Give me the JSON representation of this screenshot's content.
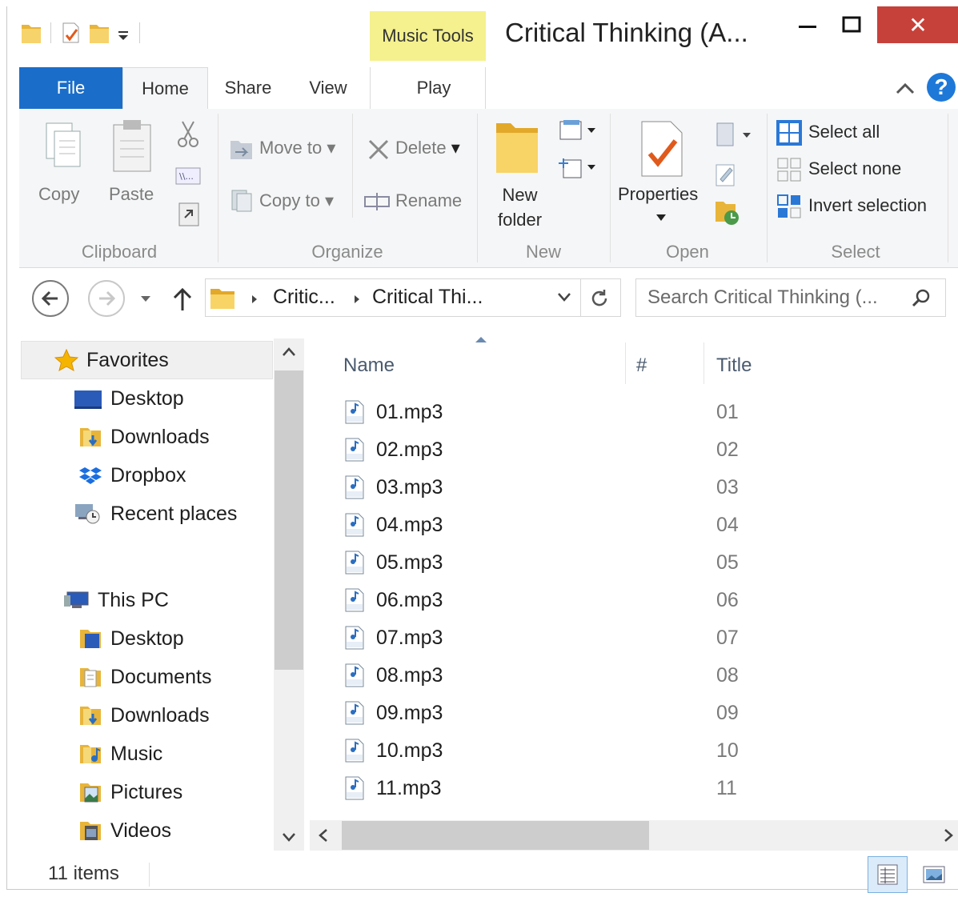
{
  "titlebar": {
    "context_tab": "Music Tools",
    "title": "Critical Thinking (A...",
    "close_glyph": "✕"
  },
  "tabs": {
    "file": "File",
    "home": "Home",
    "share": "Share",
    "view": "View",
    "play": "Play"
  },
  "ribbon": {
    "clipboard": {
      "copy": "Copy",
      "paste": "Paste",
      "label": "Clipboard"
    },
    "organize": {
      "move_to": "Move to",
      "copy_to": "Copy to",
      "delete": "Delete",
      "rename": "Rename",
      "label": "Organize"
    },
    "new": {
      "new_folder_line1": "New",
      "new_folder_line2": "folder",
      "label": "New"
    },
    "open": {
      "properties": "Properties",
      "label": "Open"
    },
    "select": {
      "select_all": "Select all",
      "select_none": "Select none",
      "invert": "Invert selection",
      "label": "Select"
    }
  },
  "address": {
    "crumb1": "Critic...",
    "crumb2": "Critical Thi...",
    "search_placeholder": "Search Critical Thinking (..."
  },
  "nav": {
    "favorites": "Favorites",
    "fav_items": [
      "Desktop",
      "Downloads",
      "Dropbox",
      "Recent places"
    ],
    "this_pc": "This PC",
    "pc_items": [
      "Desktop",
      "Documents",
      "Downloads",
      "Music",
      "Pictures",
      "Videos"
    ]
  },
  "columns": {
    "name": "Name",
    "number": "#",
    "title": "Title"
  },
  "files": [
    {
      "name": "01.mp3",
      "title": "01"
    },
    {
      "name": "02.mp3",
      "title": "02"
    },
    {
      "name": "03.mp3",
      "title": "03"
    },
    {
      "name": "04.mp3",
      "title": "04"
    },
    {
      "name": "05.mp3",
      "title": "05"
    },
    {
      "name": "06.mp3",
      "title": "06"
    },
    {
      "name": "07.mp3",
      "title": "07"
    },
    {
      "name": "08.mp3",
      "title": "08"
    },
    {
      "name": "09.mp3",
      "title": "09"
    },
    {
      "name": "10.mp3",
      "title": "10"
    },
    {
      "name": "11.mp3",
      "title": "11"
    }
  ],
  "status": {
    "items": "11 items"
  },
  "colors": {
    "file_tab": "#1a6ec9",
    "context_tab": "#f4f18e",
    "close": "#c7413b",
    "accent_blue": "#1e78d8"
  }
}
